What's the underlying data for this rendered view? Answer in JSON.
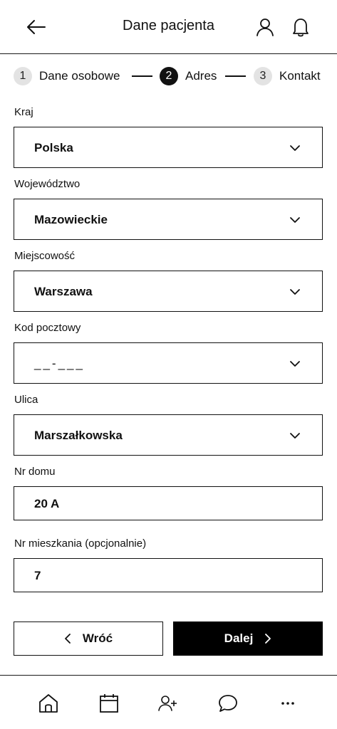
{
  "header": {
    "title": "Dane pacjenta",
    "icons": [
      "back-arrow-icon",
      "user-icon",
      "bell-icon"
    ]
  },
  "stepper": {
    "steps": [
      {
        "number": "1",
        "label": "Dane osobowe",
        "state": "inactive"
      },
      {
        "number": "2",
        "label": "Adres",
        "state": "active"
      },
      {
        "number": "3",
        "label": "Kontakt",
        "state": "inactive"
      }
    ]
  },
  "form": {
    "country": {
      "label": "Kraj",
      "value": "Polska"
    },
    "voivodeship": {
      "label": "Województwo",
      "value": "Mazowieckie"
    },
    "city": {
      "label": "Miejscowość",
      "value": "Warszawa"
    },
    "postal_code": {
      "label": "Kod pocztowy",
      "value": "__-___"
    },
    "street": {
      "label": "Ulica",
      "value": "Marszałkowska"
    },
    "house_number": {
      "label": "Nr domu",
      "value": "20 A"
    },
    "apartment_number": {
      "label": "Nr mieszkania (opcjonalnie)",
      "value": "7"
    }
  },
  "actions": {
    "back_label": "Wróć",
    "next_label": "Dalej"
  },
  "bottom_nav": {
    "items": [
      "home-icon",
      "calendar-icon",
      "add-user-icon",
      "chat-icon",
      "more-icon"
    ]
  },
  "colors": {
    "primary": "#000000",
    "border": "#111111",
    "inactive_step": "#e3e3e3",
    "background": "#ffffff"
  }
}
